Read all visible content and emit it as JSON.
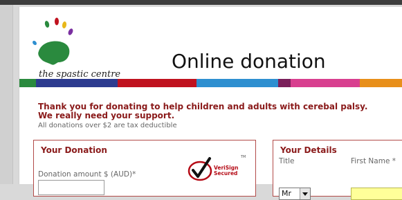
{
  "logo": {
    "text": "the spastic centre"
  },
  "page": {
    "heading": "Online donation"
  },
  "stripe_colors": [
    "#2a8a3e",
    "#2d3b8f",
    "#c0121f",
    "#2e8fd0",
    "#7a1f5a",
    "#d83f8f",
    "#e88f1a"
  ],
  "intro": {
    "line1": "Thank you for donating to help children and adults with cerebal palsy.",
    "line2": "We really need your support.",
    "tax_note": "All donations over $2 are tax deductible"
  },
  "donation": {
    "title": "Your Donation",
    "amount_label": "Donation amount $ (AUD)*",
    "amount_value": ""
  },
  "verisign": {
    "line1": "VeriSign",
    "line2": "Secured",
    "tm": "TM"
  },
  "details": {
    "title": "Your Details",
    "title_label": "Title",
    "title_value": "Mr",
    "first_name_label": "First Name *",
    "first_name_value": ""
  }
}
